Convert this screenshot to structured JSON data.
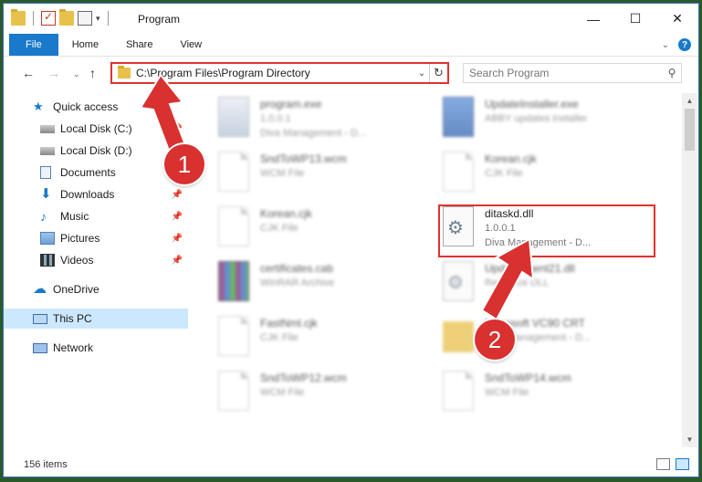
{
  "window": {
    "title": "Program"
  },
  "controls": {
    "minimize": "—",
    "maximize": "☐",
    "close": "✕"
  },
  "ribbon": {
    "tabs": [
      "File",
      "Home",
      "Share",
      "View"
    ]
  },
  "address": {
    "path": "C:\\Program Files\\Program Directory"
  },
  "search": {
    "placeholder": "Search Program"
  },
  "sidebar": {
    "items": [
      {
        "label": "Quick access"
      },
      {
        "label": "Local Disk (C:)"
      },
      {
        "label": "Local Disk (D:)"
      },
      {
        "label": "Documents"
      },
      {
        "label": "Downloads"
      },
      {
        "label": "Music"
      },
      {
        "label": "Pictures"
      },
      {
        "label": "Videos"
      },
      {
        "label": "OneDrive"
      },
      {
        "label": "This PC"
      },
      {
        "label": "Network"
      }
    ]
  },
  "files": [
    {
      "name": "program.exe",
      "line2": "1.0.0.1",
      "line3": "Diva Management - D..."
    },
    {
      "name": "UpdateInstaller.exe",
      "line2": "ABBY updates installer",
      "line3": ""
    },
    {
      "name": "SndToWP13.wcm",
      "line2": "WCM File",
      "line3": ""
    },
    {
      "name": "Korean.cjk",
      "line2": "CJK File",
      "line3": ""
    },
    {
      "name": "Korean.cjk",
      "line2": "CJK File",
      "line3": ""
    },
    {
      "name": "ditaskd.dll",
      "line2": "1.0.0.1",
      "line3": "Diva Management - D..."
    },
    {
      "name": "certificates.cab",
      "line2": "WinRAR Archive",
      "line3": ""
    },
    {
      "name": "UpdateAgent21.dll",
      "line2": "Resource DLL",
      "line3": ""
    },
    {
      "name": "FastNml.cjk",
      "line2": "CJK File",
      "line3": ""
    },
    {
      "name": "Microsoft VC90 CRT",
      "line2": "Diva Management - D...",
      "line3": ""
    },
    {
      "name": "SndToWP12.wcm",
      "line2": "WCM File",
      "line3": ""
    },
    {
      "name": "SndToWP14.wcm",
      "line2": "WCM File",
      "line3": ""
    }
  ],
  "status": {
    "count": "156 items"
  },
  "callouts": [
    "1",
    "2"
  ],
  "colors": {
    "accent": "#1979ca",
    "highlight": "#e0322f",
    "selection": "#cce8ff"
  }
}
